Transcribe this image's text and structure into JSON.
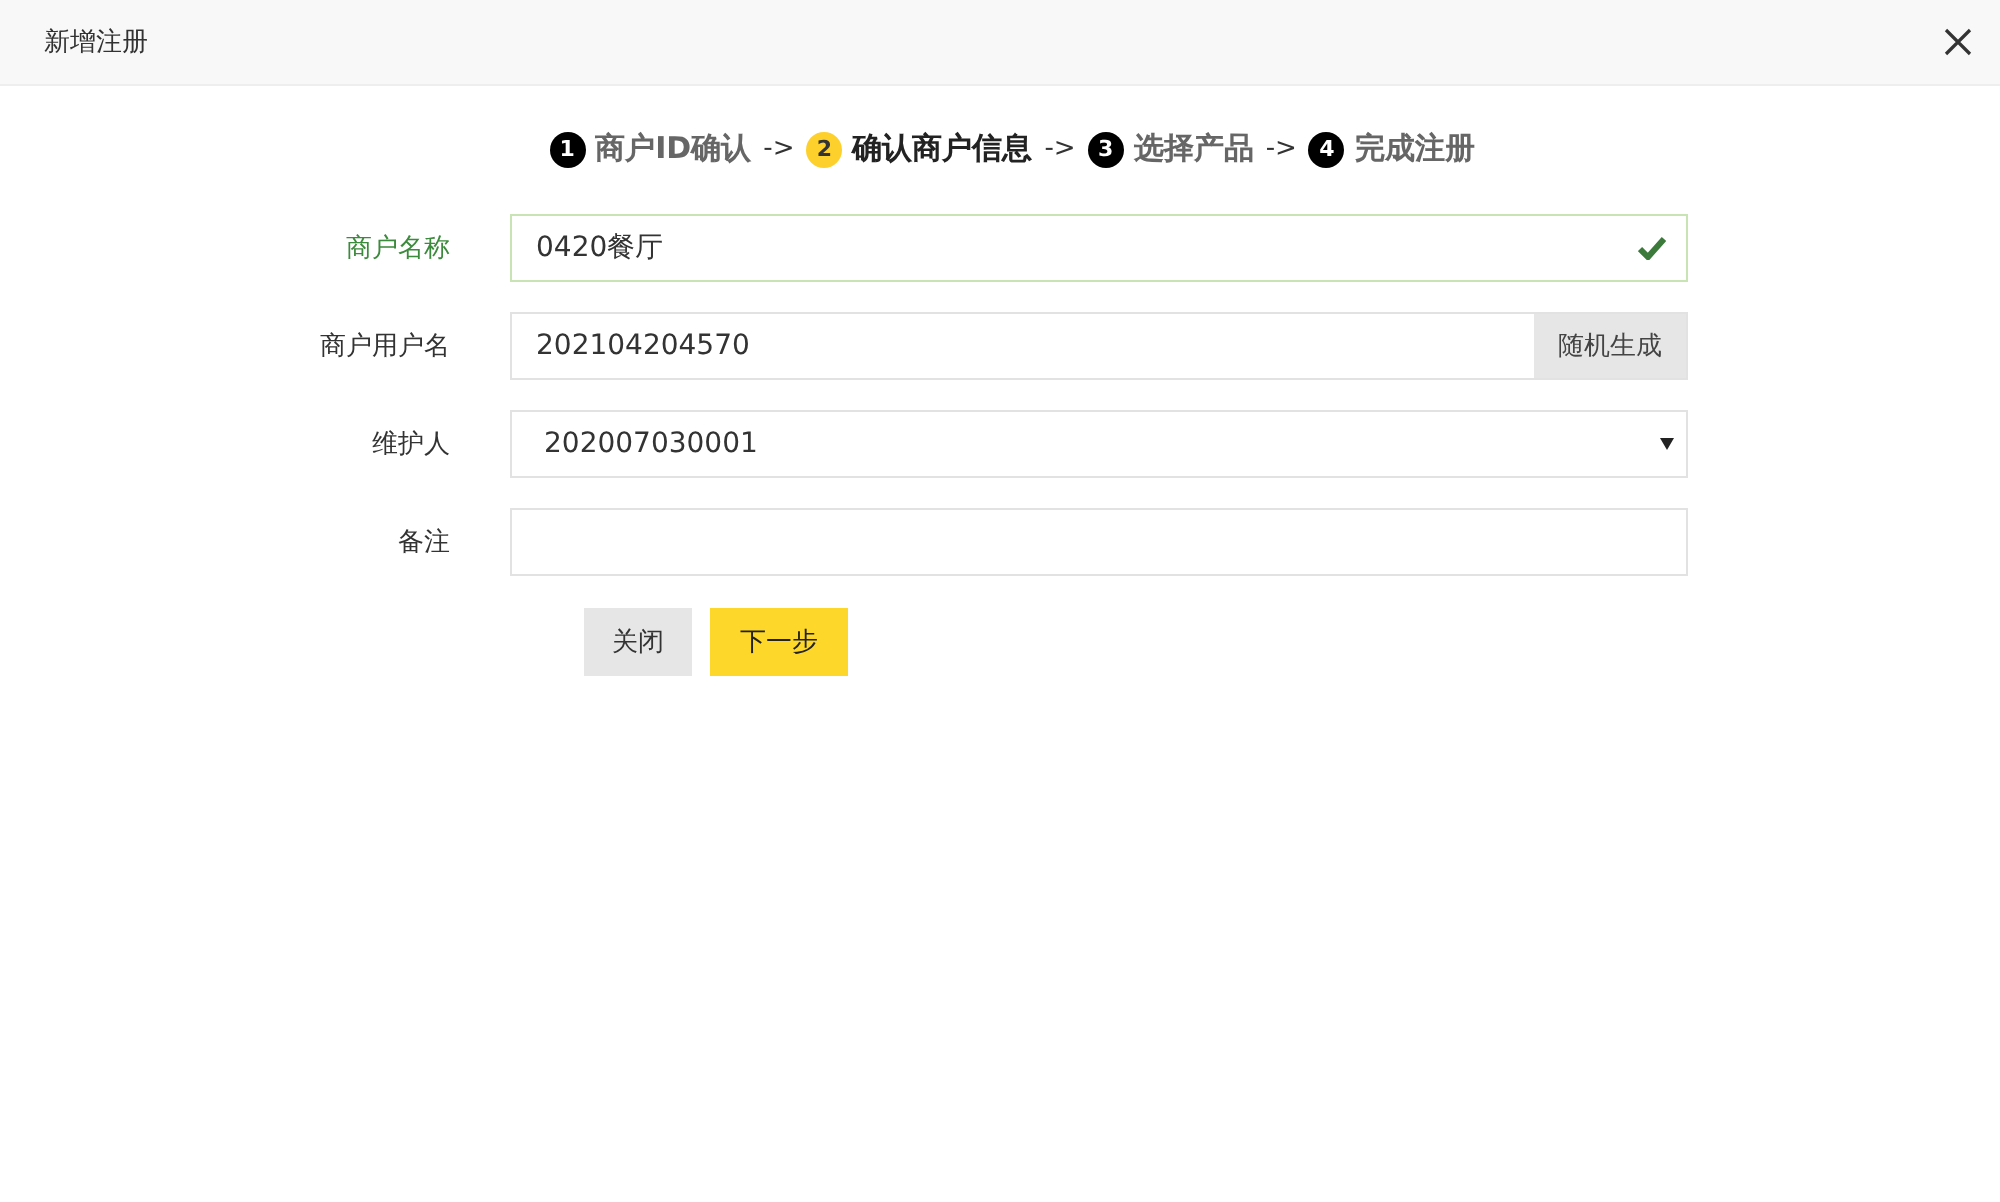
{
  "dialog": {
    "title": "新增注册"
  },
  "steps": [
    {
      "number": "1",
      "label": "商户ID确认",
      "selected": false
    },
    {
      "number": "2",
      "label": "确认商户信息",
      "selected": true
    },
    {
      "number": "3",
      "label": "选择产品",
      "selected": false
    },
    {
      "number": "4",
      "label": "完成注册",
      "selected": false
    }
  ],
  "step_separators": [
    "->",
    "->",
    "->"
  ],
  "fields": [
    {
      "label": "商户名称",
      "kind": "input",
      "value": "0420餐厅",
      "valid": true
    },
    {
      "label": "商户用户名",
      "kind": "input-button",
      "value": "202104204570",
      "button": "随机生成",
      "valid": false
    },
    {
      "label": "维护人",
      "kind": "select",
      "value": "202007030001",
      "valid": false
    },
    {
      "label": "备注",
      "kind": "input",
      "valid": false
    }
  ],
  "buttons": [
    {
      "label": "关闭",
      "kind": "secondary"
    },
    {
      "label": "下一步",
      "kind": "primary"
    }
  ]
}
